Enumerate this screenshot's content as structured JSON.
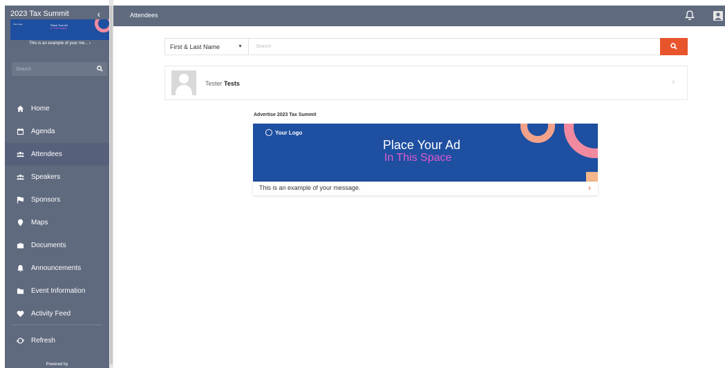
{
  "sidebar": {
    "event_title": "2023 Tax Summit",
    "collapse_icon": "chevron-left-icon",
    "mini_ad": {
      "logo": "Your Logo",
      "line1": "Place Your Ad",
      "line2": "In This Space",
      "message": "This is an example of your me... ›"
    },
    "search_placeholder": "Search",
    "search_icon": "search-icon",
    "items": [
      {
        "label": "Home",
        "icon": "home-icon",
        "active": false
      },
      {
        "label": "Agenda",
        "icon": "calendar-icon",
        "active": false
      },
      {
        "label": "Attendees",
        "icon": "users-icon",
        "active": true
      },
      {
        "label": "Speakers",
        "icon": "users-icon",
        "active": false
      },
      {
        "label": "Sponsors",
        "icon": "flag-icon",
        "active": false
      },
      {
        "label": "Maps",
        "icon": "map-pin-icon",
        "active": false
      },
      {
        "label": "Documents",
        "icon": "briefcase-icon",
        "active": false
      },
      {
        "label": "Announcements",
        "icon": "bell-icon",
        "active": false
      },
      {
        "label": "Event Information",
        "icon": "folder-icon",
        "active": false
      },
      {
        "label": "Activity Feed",
        "icon": "heart-icon",
        "active": false
      }
    ],
    "refresh_label": "Refresh",
    "refresh_icon": "refresh-icon",
    "powered_by": "Powered by"
  },
  "topbar": {
    "title": "Attendees",
    "bell_icon": "bell-icon",
    "user_icon": "user-icon"
  },
  "filter": {
    "selected_field": "First & Last Name",
    "search_placeholder": "Search",
    "search_button_icon": "search-icon"
  },
  "attendees": [
    {
      "first_name": "Tester",
      "last_name": "Tests"
    }
  ],
  "advertisement": {
    "label": "Advertise 2023 Tax Summit",
    "logo": "Your Logo",
    "line1": "Place Your Ad",
    "line2": "In This Space",
    "message": "This is an example of your message."
  },
  "colors": {
    "sidebar_bg": "#5f6a7e",
    "accent": "#e8542c",
    "ad_bg": "#1e4fa0",
    "ad_highlight": "#e05ad0"
  }
}
